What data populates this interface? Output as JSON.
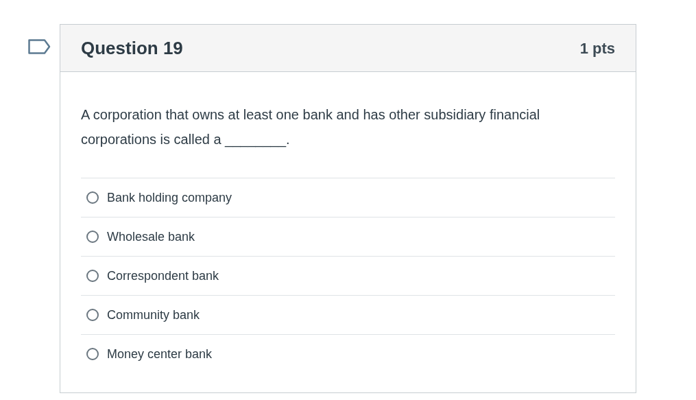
{
  "question": {
    "title": "Question 19",
    "points": "1 pts",
    "text": "A corporation that owns at least one bank and has other subsidiary financial corporations is called a ________.",
    "flagged": false,
    "answers": [
      {
        "label": "Bank holding company",
        "selected": false
      },
      {
        "label": "Wholesale bank",
        "selected": false
      },
      {
        "label": "Correspondent bank",
        "selected": false
      },
      {
        "label": "Community bank",
        "selected": false
      },
      {
        "label": "Money center bank",
        "selected": false
      }
    ]
  }
}
